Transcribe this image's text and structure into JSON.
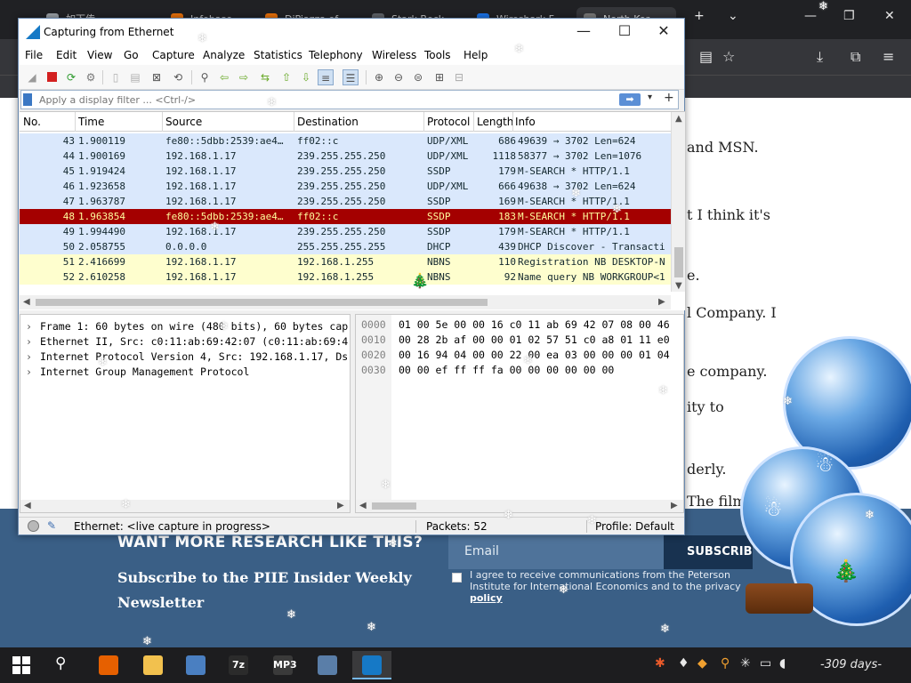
{
  "browser": {
    "tabs": [
      {
        "label": "如下传",
        "color": "#9aa0a6"
      },
      {
        "label": "Infobase",
        "color": "#e8710a"
      },
      {
        "label": "DiPiazza of",
        "color": "#e8710a"
      },
      {
        "label": "Stark Beck",
        "color": "#5f6368"
      },
      {
        "label": "Wireshark F",
        "color": "#1a73e8"
      },
      {
        "label": "North Kor",
        "color": "#7a7a7a"
      }
    ]
  },
  "article": {
    "fragments": [
      "and MSN.",
      "t I think it's",
      "e.",
      "l Company. I",
      "e company.",
      "ity to",
      "derly.",
      "The film"
    ]
  },
  "footer": {
    "heading": "WANT MORE RESEARCH LIKE THIS?",
    "sub_line1": "Subscribe to the PIIE Insider Weekly",
    "sub_line2": "Newsletter",
    "email_placeholder": "Email",
    "subscribe_label": "SUBSCRIBE",
    "agree_line1": "I agree to receive communications from the Peterson",
    "agree_line2": "Institute for International Economics and to the privacy",
    "agree_link": "policy"
  },
  "wireshark": {
    "title": "Capturing from Ethernet",
    "menu": [
      "File",
      "Edit",
      "View",
      "Go",
      "Capture",
      "Analyze",
      "Statistics",
      "Telephony",
      "Wireless",
      "Tools",
      "Help"
    ],
    "filter_placeholder": "Apply a display filter ... <Ctrl-/>",
    "columns": [
      "No.",
      "Time",
      "Source",
      "Destination",
      "Protocol",
      "Length",
      "Info"
    ],
    "packets": [
      {
        "no": "43",
        "time": "1.900119",
        "src": "fe80::5dbb:2539:ae4…",
        "dst": "ff02::c",
        "proto": "UDP/XML",
        "len": "686",
        "info": "49639 → 3702 Len=624",
        "bg": "#dae8fc",
        "fg": "#12272e"
      },
      {
        "no": "44",
        "time": "1.900169",
        "src": "192.168.1.17",
        "dst": "239.255.255.250",
        "proto": "UDP/XML",
        "len": "1118",
        "info": "58377 → 3702 Len=1076",
        "bg": "#dae8fc",
        "fg": "#12272e"
      },
      {
        "no": "45",
        "time": "1.919424",
        "src": "192.168.1.17",
        "dst": "239.255.255.250",
        "proto": "SSDP",
        "len": "179",
        "info": "M-SEARCH * HTTP/1.1",
        "bg": "#dae8fc",
        "fg": "#12272e"
      },
      {
        "no": "46",
        "time": "1.923658",
        "src": "192.168.1.17",
        "dst": "239.255.255.250",
        "proto": "UDP/XML",
        "len": "666",
        "info": "49638 → 3702 Len=624",
        "bg": "#dae8fc",
        "fg": "#12272e"
      },
      {
        "no": "47",
        "time": "1.963787",
        "src": "192.168.1.17",
        "dst": "239.255.255.250",
        "proto": "SSDP",
        "len": "169",
        "info": "M-SEARCH * HTTP/1.1",
        "bg": "#dae8fc",
        "fg": "#12272e"
      },
      {
        "no": "48",
        "time": "1.963854",
        "src": "fe80::5dbb:2539:ae4…",
        "dst": "ff02::c",
        "proto": "SSDP",
        "len": "183",
        "info": "M-SEARCH * HTTP/1.1",
        "bg": "#a40000",
        "fg": "#fffc9c"
      },
      {
        "no": "49",
        "time": "1.994490",
        "src": "192.168.1.17",
        "dst": "239.255.255.250",
        "proto": "SSDP",
        "len": "179",
        "info": "M-SEARCH * HTTP/1.1",
        "bg": "#dae8fc",
        "fg": "#12272e"
      },
      {
        "no": "50",
        "time": "2.058755",
        "src": "0.0.0.0",
        "dst": "255.255.255.255",
        "proto": "DHCP",
        "len": "439",
        "info": "DHCP Discover - Transacti",
        "bg": "#dae8fc",
        "fg": "#12272e"
      },
      {
        "no": "51",
        "time": "2.416699",
        "src": "192.168.1.17",
        "dst": "192.168.1.255",
        "proto": "NBNS",
        "len": "110",
        "info": "Registration NB DESKTOP-N",
        "bg": "#fefece",
        "fg": "#12272e"
      },
      {
        "no": "52",
        "time": "2.610258",
        "src": "192.168.1.17",
        "dst": "192.168.1.255",
        "proto": "NBNS",
        "len": "92",
        "info": "Name query NB WORKGROUP<1",
        "bg": "#fefece",
        "fg": "#12272e"
      }
    ],
    "details": [
      "Frame 1: 60 bytes on wire (480 bits), 60 bytes cap",
      "Ethernet II, Src: c0:11:ab:69:42:07 (c0:11:ab:69:4",
      "Internet Protocol Version 4, Src: 192.168.1.17, Ds",
      "Internet Group Management Protocol"
    ],
    "hex": [
      {
        "offset": "0000",
        "bytes": "01 00 5e 00 00 16 c0 11  ab 69 42 07 08 00 46"
      },
      {
        "offset": "0010",
        "bytes": "00 28 2b af 00 00 01 02  57 51 c0 a8 01 11 e0"
      },
      {
        "offset": "0020",
        "bytes": "00 16 94 04 00 00 22 00  ea 03 00 00 00 01 04"
      },
      {
        "offset": "0030",
        "bytes": "00 00 ef ff ff fa 00 00  00 00 00 00"
      }
    ],
    "status": {
      "capture": "Ethernet: <live capture in progress>",
      "packets": "Packets: 52",
      "profile": "Profile: Default"
    }
  },
  "taskbar": {
    "apps": [
      {
        "name": "taskbar-firefox-icon",
        "glyph": "",
        "color": "#e66000"
      },
      {
        "name": "taskbar-file-explorer-icon",
        "glyph": "",
        "color": "#f2c14e"
      },
      {
        "name": "taskbar-app-people-icon",
        "glyph": "",
        "color": "#4a7fc1"
      },
      {
        "name": "taskbar-7zip-icon",
        "glyph": "7z",
        "color": "#2b2b2b"
      },
      {
        "name": "taskbar-mp3-icon",
        "glyph": "MP3",
        "color": "#3a3a3a"
      },
      {
        "name": "taskbar-network-icon",
        "glyph": "",
        "color": "#5a7ea8"
      },
      {
        "name": "taskbar-wireshark-icon",
        "glyph": "",
        "color": "#1679c6"
      }
    ],
    "days_counter": "-309 days-"
  }
}
